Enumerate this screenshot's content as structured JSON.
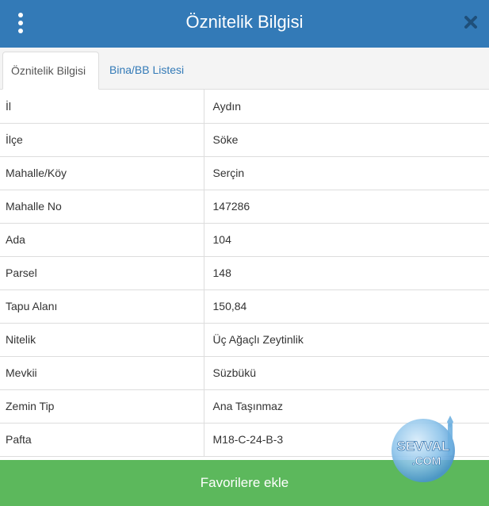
{
  "header": {
    "title": "Öznitelik Bilgisi"
  },
  "tabs": [
    {
      "label": "Öznitelik Bilgisi",
      "active": true
    },
    {
      "label": "Bina/BB Listesi",
      "active": false
    }
  ],
  "rows": [
    {
      "key": "İl",
      "value": "Aydın"
    },
    {
      "key": "İlçe",
      "value": "Söke"
    },
    {
      "key": "Mahalle/Köy",
      "value": "Serçin"
    },
    {
      "key": "Mahalle No",
      "value": "147286"
    },
    {
      "key": "Ada",
      "value": "104"
    },
    {
      "key": "Parsel",
      "value": "148"
    },
    {
      "key": "Tapu Alanı",
      "value": "150,84"
    },
    {
      "key": "Nitelik",
      "value": "Üç Ağaçlı Zeytinlik"
    },
    {
      "key": "Mevkii",
      "value": "Süzbükü"
    },
    {
      "key": "Zemin Tip",
      "value": "Ana Taşınmaz"
    },
    {
      "key": "Pafta",
      "value": "M18-C-24-B-3"
    }
  ],
  "footer": {
    "favorite_label": "Favorilere ekle"
  },
  "watermark": {
    "text_top": "SEVVAL",
    "text_bottom": ".COM"
  },
  "colors": {
    "header": "#337ab7",
    "favorite_button": "#5cb85c",
    "tab_link": "#337ab7"
  },
  "icons": {
    "menu": "vertical-dots-icon",
    "close": "close-icon"
  }
}
